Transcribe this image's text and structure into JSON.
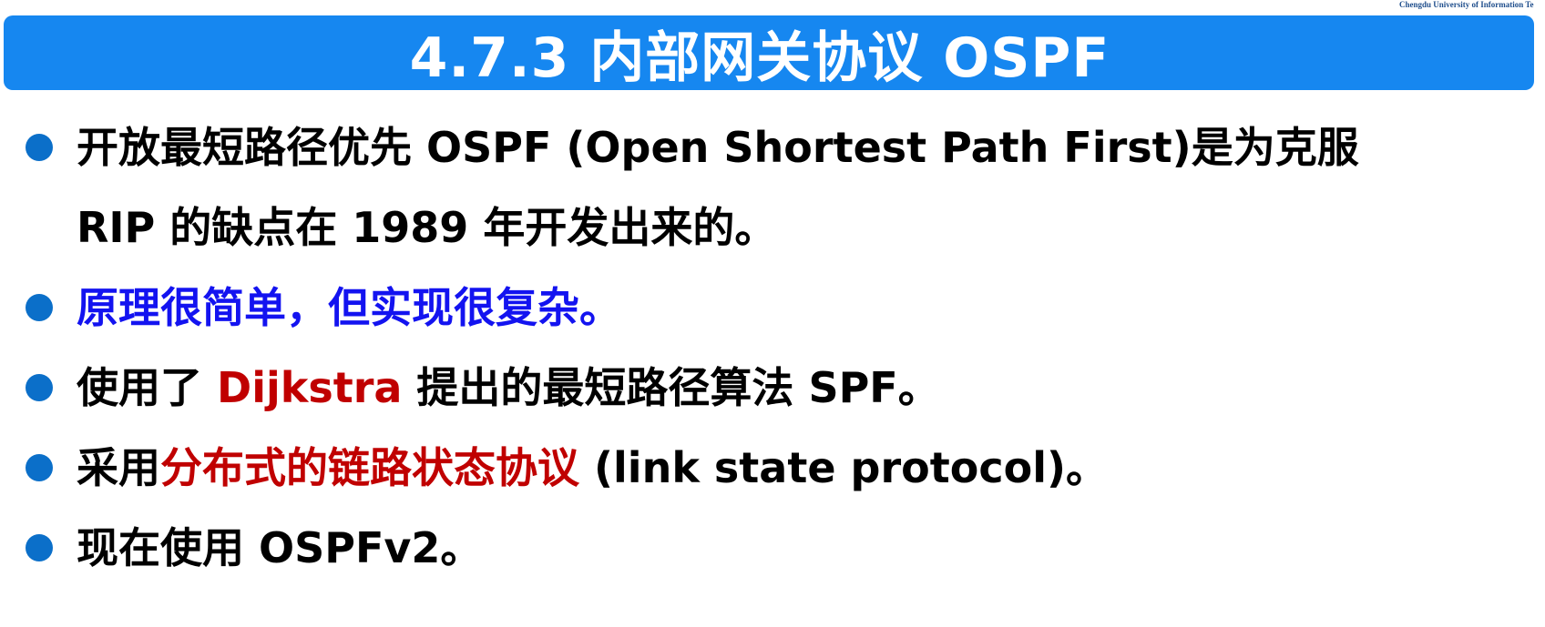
{
  "watermark": "Chengdu University of Information Te",
  "title": "4.7.3  内部网关协议 OSPF",
  "colors": {
    "title_bar": "#1687f0",
    "bullet_dot": "#0b6fc9",
    "highlight_blue": "#1313f0",
    "highlight_red": "#c00000"
  },
  "bullets": [
    {
      "line1": "开放最短路径优先 OSPF (Open Shortest Path First)是为克服",
      "line2": "RIP 的缺点在 1989 年开发出来的。"
    },
    {
      "text": "原理很简单，但实现很复杂。"
    },
    {
      "pre": "使用了 ",
      "highlight": "Dijkstra",
      "post": " 提出的最短路径算法 SPF。"
    },
    {
      "pre": "采用",
      "highlight": "分布式的链路状态协议",
      "post": " (link state protocol)。"
    },
    {
      "text": "现在使用 OSPFv2。"
    }
  ]
}
